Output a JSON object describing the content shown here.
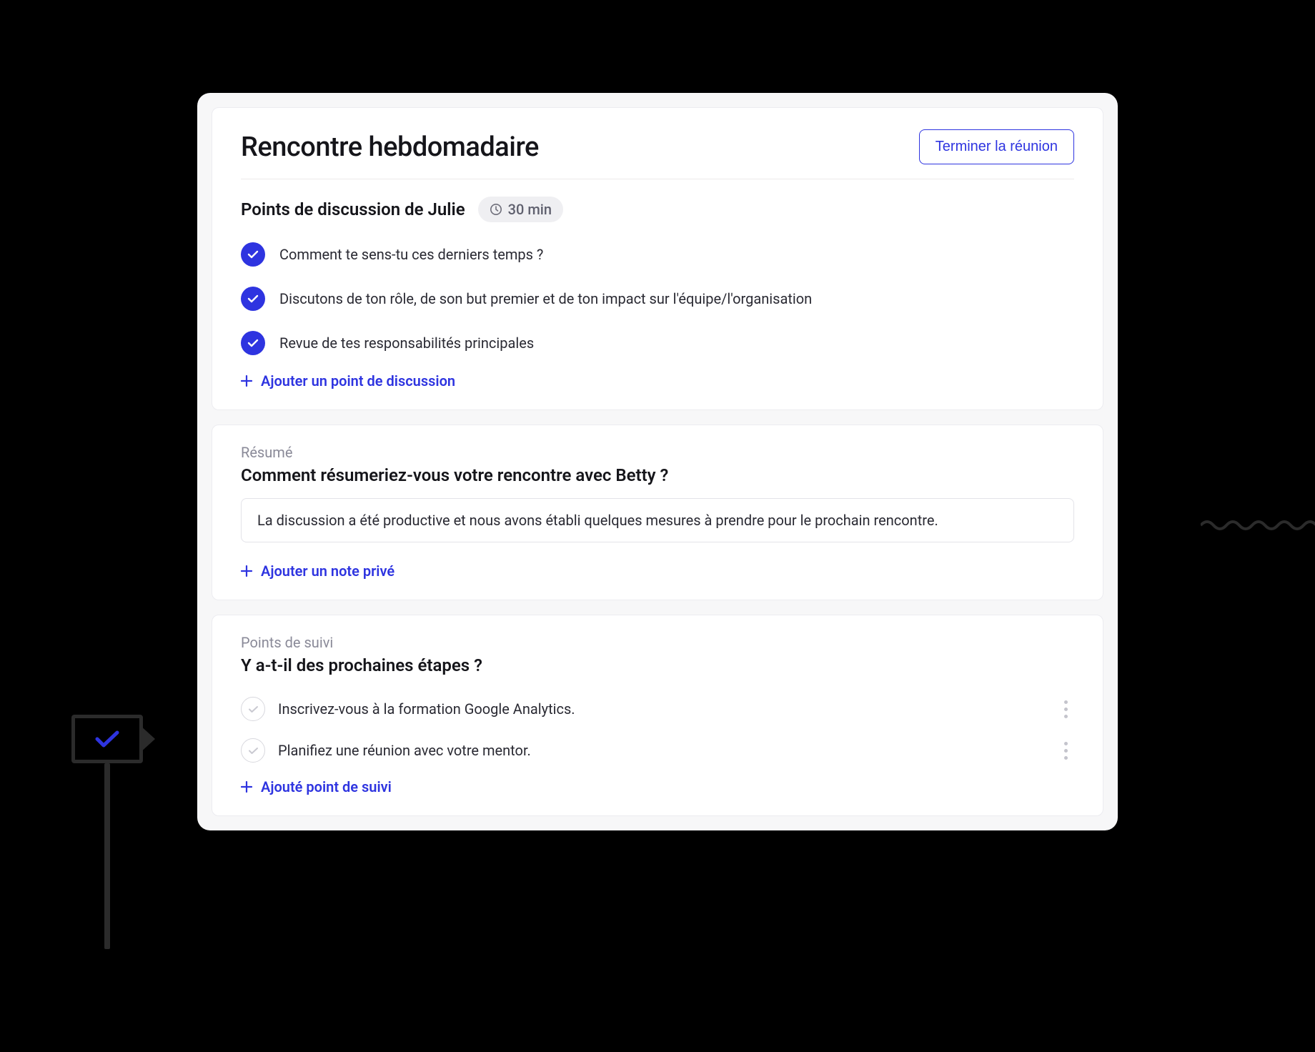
{
  "header": {
    "title": "Rencontre hebdomadaire",
    "end_button": "Terminer la réunion"
  },
  "discussion": {
    "title": "Points de discussion de Julie",
    "duration_label": "30 min",
    "items": [
      "Comment te sens-tu ces derniers temps ?",
      "Discutons de ton rôle, de son but premier et de ton impact sur l'équipe/l'organisation",
      "Revue de tes responsabilités principales"
    ],
    "add_label": "Ajouter un point de discussion"
  },
  "summary": {
    "label": "Résumé",
    "prompt": "Comment résumeriez-vous votre rencontre avec Betty ?",
    "value": "La discussion a été productive et nous avons établi quelques mesures à prendre pour le prochain rencontre.",
    "add_label": "Ajouter un note privé"
  },
  "followups": {
    "label": "Points de suivi",
    "prompt": "Y a-t-il des prochaines étapes ?",
    "items": [
      "Inscrivez-vous à la formation Google Analytics.",
      "Planifiez une réunion avec votre mentor."
    ],
    "add_label": "Ajouté point de suivi"
  }
}
